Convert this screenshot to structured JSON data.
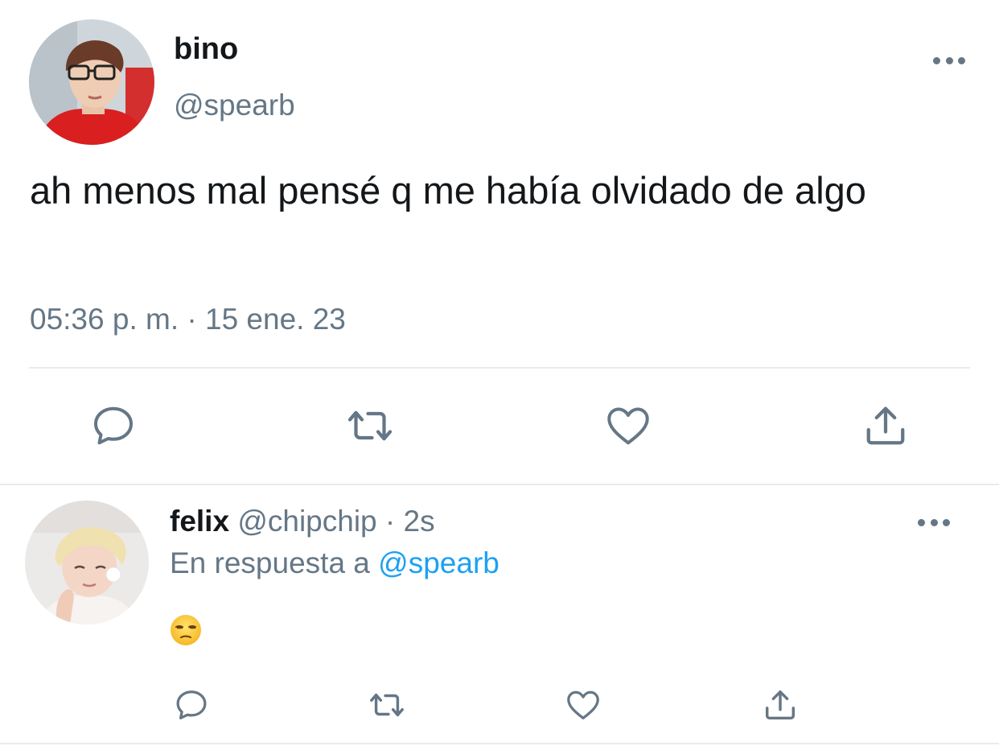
{
  "main_tweet": {
    "author_name": "bino",
    "author_handle": "@spearb",
    "text": "ah menos mal pensé q me había olvidado de algo",
    "timestamp": "05:36 p. m. · 15 ene. 23",
    "avatar_icon": "user-avatar-bino",
    "actions": [
      {
        "name": "reply",
        "icon": "speech-bubble-icon"
      },
      {
        "name": "retweet",
        "icon": "retweet-icon"
      },
      {
        "name": "like",
        "icon": "heart-icon"
      },
      {
        "name": "share",
        "icon": "share-icon"
      }
    ]
  },
  "reply": {
    "author_name": "felix",
    "author_handle": "@chipchip",
    "separator": "·",
    "time_ago": "2s",
    "reply_prefix": "En respuesta a",
    "reply_to_handle": "@spearb",
    "body_emoji": "unamused-face-emoji",
    "avatar_icon": "user-avatar-felix",
    "actions": [
      {
        "name": "reply",
        "icon": "speech-bubble-icon"
      },
      {
        "name": "retweet",
        "icon": "retweet-icon"
      },
      {
        "name": "like",
        "icon": "heart-icon"
      },
      {
        "name": "share",
        "icon": "share-icon"
      }
    ]
  },
  "colors": {
    "text_primary": "#14171a",
    "text_secondary": "#657786",
    "link": "#1da1f2",
    "divider": "#e6ecf0",
    "icon": "#657786"
  }
}
